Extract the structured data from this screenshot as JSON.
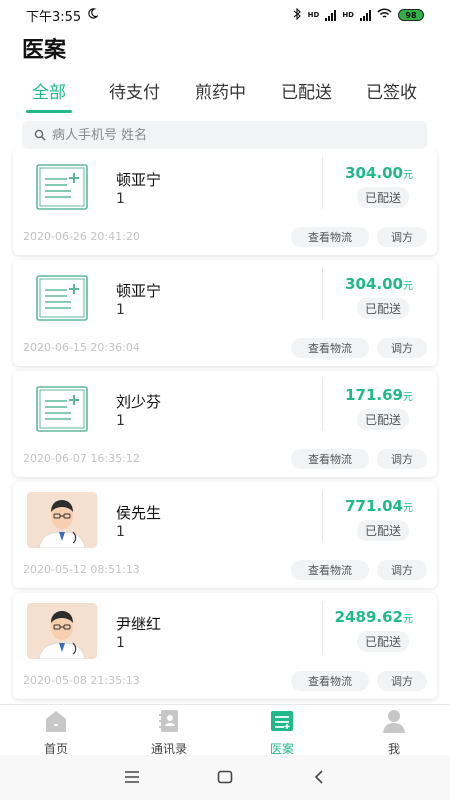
{
  "status_bar": {
    "time": "下午3:55",
    "network_label": "HD",
    "battery": "98"
  },
  "page": {
    "title": "医案"
  },
  "tabs": [
    {
      "label": "全部",
      "active": true
    },
    {
      "label": "待支付",
      "active": false
    },
    {
      "label": "煎药中",
      "active": false
    },
    {
      "label": "已配送",
      "active": false
    },
    {
      "label": "已签收",
      "active": false
    }
  ],
  "search": {
    "placeholder": "病人手机号 姓名",
    "value": ""
  },
  "orders": [
    {
      "name": "顿亚宁",
      "count": "1",
      "price": "304.00",
      "unit": "元",
      "status": "已配送",
      "date": "2020-06-26 20:41:20",
      "thumb": "prescription-icon",
      "logistics_label": "查看物流",
      "adjust_label": "调方"
    },
    {
      "name": "顿亚宁",
      "count": "1",
      "price": "304.00",
      "unit": "元",
      "status": "已配送",
      "date": "2020-06-15 20:36:04",
      "thumb": "prescription-icon",
      "logistics_label": "查看物流",
      "adjust_label": "调方"
    },
    {
      "name": "刘少芬",
      "count": "1",
      "price": "171.69",
      "unit": "元",
      "status": "已配送",
      "date": "2020-06-07 16:35:12",
      "thumb": "prescription-icon",
      "logistics_label": "查看物流",
      "adjust_label": "调方"
    },
    {
      "name": "侯先生",
      "count": "1",
      "price": "771.04",
      "unit": "元",
      "status": "已配送",
      "date": "2020-05-12 08:51:13",
      "thumb": "doctor-avatar",
      "logistics_label": "查看物流",
      "adjust_label": "调方"
    },
    {
      "name": "尹继红",
      "count": "1",
      "price": "2489.62",
      "unit": "元",
      "status": "已配送",
      "date": "2020-05-08 21:35:13",
      "thumb": "doctor-avatar",
      "logistics_label": "查看物流",
      "adjust_label": "调方"
    }
  ],
  "bottom_nav": [
    {
      "label": "首页",
      "icon": "home-icon",
      "active": false
    },
    {
      "label": "通讯录",
      "icon": "contacts-icon",
      "active": false
    },
    {
      "label": "医案",
      "icon": "case-icon",
      "active": true
    },
    {
      "label": "我",
      "icon": "profile-icon",
      "active": false
    }
  ],
  "colors": {
    "accent": "#1fb98a",
    "muted": "#c3c3c3",
    "chip_bg": "#f2f3f5"
  }
}
